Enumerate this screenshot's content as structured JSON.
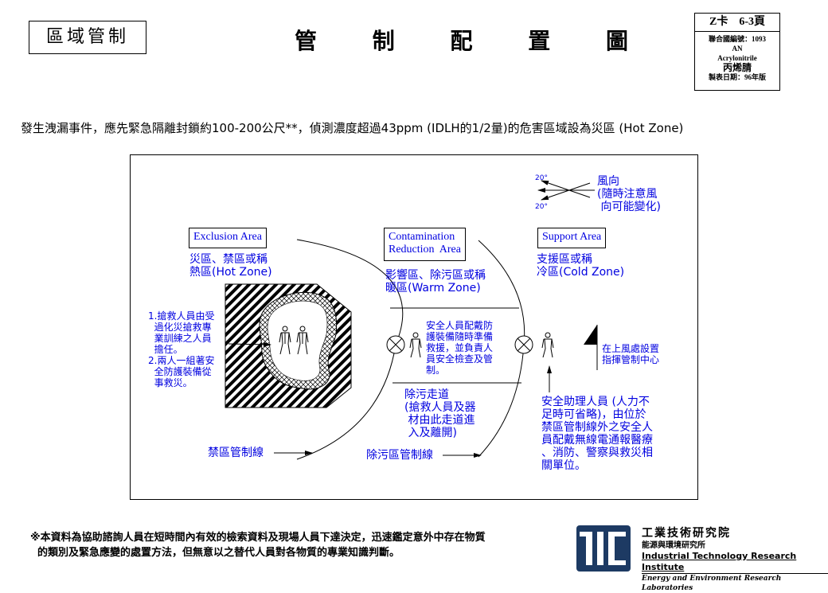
{
  "header": {
    "zone_tag": "區域管制",
    "title": "管 制 配 置 圖",
    "card": {
      "page": "Z卡　6-3頁",
      "un_label": "聯合國編號：1093",
      "abbr": "AN",
      "name_en": "Acrylonitrile",
      "name_zh": "丙烯腈",
      "date": "製表日期：96年版"
    }
  },
  "intro_text": "發生洩漏事件，應先緊急隔離封鎖約100-200公尺**，偵測濃度超過43ppm (IDLH的1/2量)的危害區域設為災區 (Hot  Zone)",
  "diagram": {
    "wind": {
      "angle_top": "20°",
      "angle_bottom": "20°",
      "label": "風向\n(隨時注意風\n 向可能變化)"
    },
    "zones": [
      {
        "title": "Exclusion Area",
        "desc": "災區、禁區或稱\n熱區(Hot Zone)"
      },
      {
        "title": "Contamination\nReduction  Area",
        "desc": "影響區、除污區或稱\n暖區(Warm Zone)"
      },
      {
        "title": "Support Area",
        "desc": "支援區或稱\n冷區(Cold Zone)"
      }
    ],
    "hot_zone_note": "1.搶救人員由受\n  過化災搶救專\n  業訓練之人員\n  擔任。\n2.兩人一組著安\n  全防護裝備從\n  事救災。",
    "warm_zone_note": "安全人員配戴防\n護裝備隨時準備\n救援，並負責人\n員安全檢查及管\n制。",
    "corridor_note": "除污走道\n(搶救人員及器\n 材由此走道進\n 入及離開)",
    "command_post": "在上風處設置\n指揮管制中心",
    "safety_assistant_note": "安全助理人員 (人力不\n足時可省略)，由位於\n禁區管制線外之安全人\n員配戴無線電通報醫療\n、消防、警察與救災相\n關單位。",
    "hot_line_label": "禁區管制線",
    "decon_line_label": "除污區管制線"
  },
  "footer": {
    "disclaimer": "※本資料為協助諮詢人員在短時間內有效的檢索資料及現場人員下達決定，迅速鑑定意外中存在物質\n  的類別及緊急應變的處置方法，但無意以之替代人員對各物質的專業知識判斷。",
    "org_zh": "工業技術研究院",
    "org_sub_zh": "能源與環境研究所",
    "org_en": "Industrial Technology Research Institute",
    "org_sub_en": "Energy and Environment Research Laboratories"
  },
  "colors": {
    "annotation": "#0000e0",
    "logo": "#1d3a63"
  }
}
